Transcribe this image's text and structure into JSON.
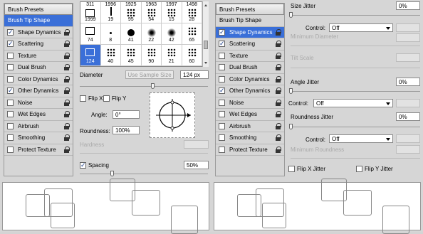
{
  "left": {
    "presets_label": "Brush Presets",
    "items": [
      {
        "label": "Brush Tip Shape",
        "checkbox": false,
        "checked": false,
        "selected": true
      },
      {
        "label": "Shape Dynamics",
        "checkbox": true,
        "checked": true
      },
      {
        "label": "Scattering",
        "checkbox": true,
        "checked": true
      },
      {
        "label": "Texture",
        "checkbox": true,
        "checked": false
      },
      {
        "label": "Dual Brush",
        "checkbox": true,
        "checked": false
      },
      {
        "label": "Color Dynamics",
        "checkbox": true,
        "checked": false
      },
      {
        "label": "Other Dynamics",
        "checkbox": true,
        "checked": true
      },
      {
        "label": "Noise",
        "checkbox": true,
        "checked": false
      },
      {
        "label": "Wet Edges",
        "checkbox": true,
        "checked": false
      },
      {
        "label": "Airbrush",
        "checkbox": true,
        "checked": false
      },
      {
        "label": "Smoothing",
        "checkbox": true,
        "checked": false
      },
      {
        "label": "Protect Texture",
        "checkbox": true,
        "checked": false
      }
    ],
    "tips": [
      {
        "top": "311",
        "bottom": "1999"
      },
      {
        "top": "1996",
        "bottom": "19"
      },
      {
        "top": "1925",
        "bottom": "95"
      },
      {
        "top": "1963",
        "bottom": "54"
      },
      {
        "top": "1997",
        "bottom": "15"
      },
      {
        "top": "1498",
        "bottom": "28"
      },
      {
        "top": "",
        "bottom": "74"
      },
      {
        "top": "",
        "bottom": "8"
      },
      {
        "top": "",
        "bottom": "41"
      },
      {
        "top": "",
        "bottom": "22"
      },
      {
        "top": "",
        "bottom": "42"
      },
      {
        "top": "",
        "bottom": "65"
      },
      {
        "top": "",
        "bottom": "124"
      },
      {
        "top": "",
        "bottom": "40"
      },
      {
        "top": "",
        "bottom": "45"
      },
      {
        "top": "",
        "bottom": "90"
      },
      {
        "top": "",
        "bottom": "21"
      },
      {
        "top": "",
        "bottom": "60"
      }
    ],
    "diameter_label": "Diameter",
    "use_sample_label": "Use Sample Size",
    "diameter_value": "124 px",
    "flipx_label": "Flip X",
    "flipy_label": "Flip Y",
    "angle_label": "Angle:",
    "angle_value": "0°",
    "roundness_label": "Roundness:",
    "roundness_value": "100%",
    "hardness_label": "Hardness",
    "spacing_label": "Spacing",
    "spacing_value": "50%"
  },
  "right": {
    "presets_label": "Brush Presets",
    "items": [
      {
        "label": "Brush Tip Shape",
        "checkbox": false,
        "checked": false
      },
      {
        "label": "Shape Dynamics",
        "checkbox": true,
        "checked": true,
        "selected": true
      },
      {
        "label": "Scattering",
        "checkbox": true,
        "checked": true
      },
      {
        "label": "Texture",
        "checkbox": true,
        "checked": false
      },
      {
        "label": "Dual Brush",
        "checkbox": true,
        "checked": false
      },
      {
        "label": "Color Dynamics",
        "checkbox": true,
        "checked": false
      },
      {
        "label": "Other Dynamics",
        "checkbox": true,
        "checked": true
      },
      {
        "label": "Noise",
        "checkbox": true,
        "checked": false
      },
      {
        "label": "Wet Edges",
        "checkbox": true,
        "checked": false
      },
      {
        "label": "Airbrush",
        "checkbox": true,
        "checked": false
      },
      {
        "label": "Smoothing",
        "checkbox": true,
        "checked": false
      },
      {
        "label": "Protect Texture",
        "checkbox": true,
        "checked": false
      }
    ],
    "size_jitter_label": "Size Jitter",
    "size_jitter_value": "0%",
    "control_label": "Control:",
    "control_value": "Off",
    "min_diameter_label": "Minimum Diameter",
    "tilt_scale_label": "Tilt Scale",
    "angle_jitter_label": "Angle Jitter",
    "angle_jitter_value": "0%",
    "roundness_jitter_label": "Roundness Jitter",
    "roundness_jitter_value": "0%",
    "min_roundness_label": "Minimum Roundness",
    "flipx_jitter_label": "Flip X Jitter",
    "flipy_jitter_label": "Flip Y Jitter"
  }
}
